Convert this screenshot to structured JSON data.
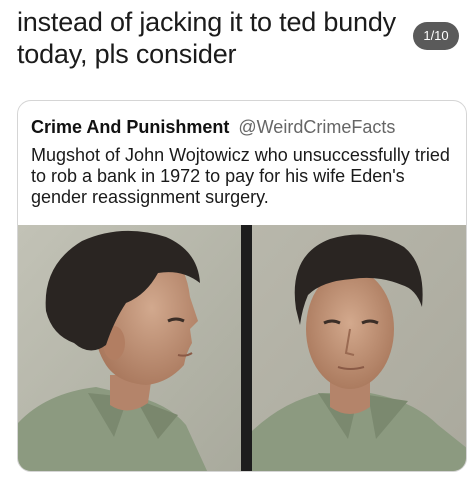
{
  "post": {
    "caption": "instead of jacking it to ted bundy today, pls consider",
    "page_indicator": "1/10"
  },
  "quote": {
    "author_name": "Crime And Punishment",
    "author_handle": "@WeirdCrimeFacts",
    "text": "Mugshot of John Wojtowicz who unsuccessfully tried to rob a bank in 1972 to pay for his wife Eden's gender reassignment surgery."
  },
  "colors": {
    "background": "#ffffff",
    "badge": "#5a5a5a",
    "handle": "#666666",
    "photo_background": "#b7b7ac",
    "divider": "#1d1d1d",
    "shirt": "#8c9a80",
    "hair": "#2a2522",
    "skin": "#c49a7e"
  },
  "icons": [
    "mugshot-photo"
  ]
}
